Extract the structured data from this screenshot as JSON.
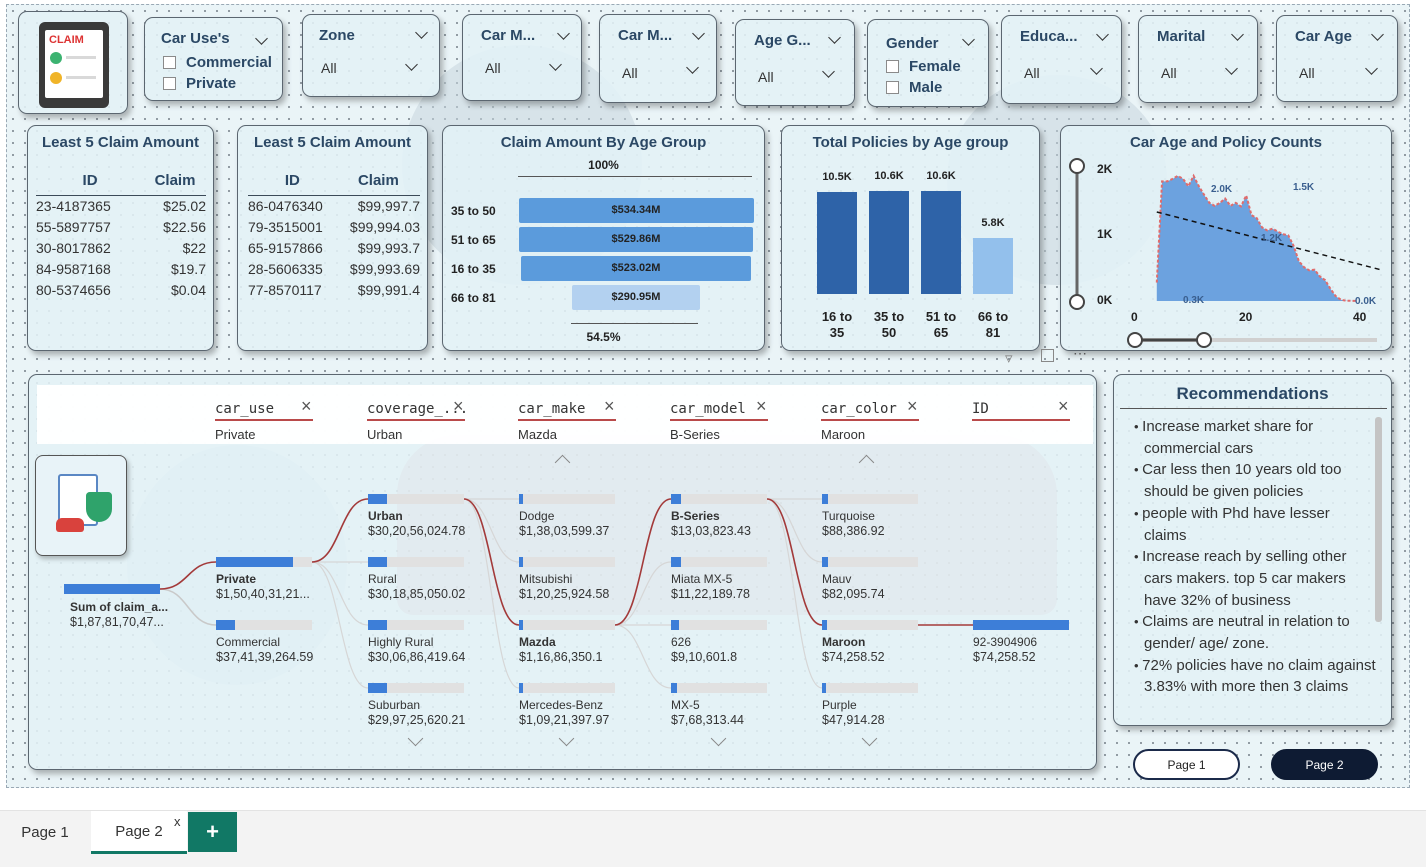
{
  "slicers": [
    {
      "title": "Car Use's",
      "type": "list",
      "options": [
        "Commercial",
        "Private"
      ]
    },
    {
      "title": "Zone",
      "type": "dropdown",
      "value": "All"
    },
    {
      "title": "Car M...",
      "type": "dropdown",
      "value": "All"
    },
    {
      "title": "Car M...",
      "type": "dropdown",
      "value": "All"
    },
    {
      "title": "Age G...",
      "type": "dropdown",
      "value": "All"
    },
    {
      "title": "Gender",
      "type": "list",
      "options": [
        "Female",
        "Male"
      ]
    },
    {
      "title": "Educa...",
      "type": "dropdown",
      "value": "All"
    },
    {
      "title": "Marital",
      "type": "dropdown",
      "value": "All"
    },
    {
      "title": "Car Age",
      "type": "dropdown",
      "value": "All"
    }
  ],
  "logo": {
    "text": "CLAIM"
  },
  "table_left": {
    "title": "Least 5 Claim Amount",
    "columns": [
      "ID",
      "Claim"
    ],
    "rows": [
      [
        "23-4187365",
        "$25.02"
      ],
      [
        "55-5897757",
        "$22.56"
      ],
      [
        "30-8017862",
        "$22"
      ],
      [
        "84-9587168",
        "$19.7"
      ],
      [
        "80-5374656",
        "$0.04"
      ]
    ]
  },
  "table_right": {
    "title": "Least 5 Claim Amount",
    "columns": [
      "ID",
      "Claim"
    ],
    "rows": [
      [
        "86-0476340",
        "$99,997.7"
      ],
      [
        "79-3515001",
        "$99,994.03"
      ],
      [
        "65-9157866",
        "$99,993.7"
      ],
      [
        "28-5606335",
        "$99,993.69"
      ],
      [
        "77-8570117",
        "$99,991.4"
      ]
    ]
  },
  "funnel": {
    "title": "Claim Amount By Age Group",
    "top_label": "100%",
    "bottom_label": "54.5%",
    "color": "#5b9bdc",
    "chart_data": {
      "type": "bar",
      "categories": [
        "35 to 50",
        "51 to 65",
        "16 to 35",
        "66 to 81"
      ],
      "values": [
        534.34,
        529.86,
        523.02,
        290.95
      ],
      "labels": [
        "$534.34M",
        "$529.86M",
        "$523.02M",
        "$290.95M"
      ]
    }
  },
  "policies": {
    "title": "Total Policies by Age group",
    "chart_data": {
      "type": "bar",
      "categories": [
        "16 to 35",
        "35 to 50",
        "51 to 65",
        "66 to 81"
      ],
      "values": [
        10500,
        10600,
        10600,
        5800
      ],
      "labels": [
        "10.5K",
        "10.6K",
        "10.6K",
        "5.8K"
      ]
    },
    "colors": [
      "#2e63a8",
      "#2e63a8",
      "#2e63a8",
      "#93c0ec"
    ]
  },
  "carage": {
    "title": "Car Age and Policy Counts",
    "y_ticks": [
      "2K",
      "1K",
      "0K"
    ],
    "x_ticks": [
      "0",
      "20",
      "40"
    ],
    "annotations": [
      "2.0K",
      "1.5K",
      "1.2K",
      "0.3K",
      "0.0K"
    ],
    "chart_data": {
      "type": "area",
      "x": [
        3,
        4,
        5,
        6,
        7,
        8,
        9,
        10,
        11,
        12,
        13,
        14,
        15,
        16,
        17,
        18,
        19,
        20,
        21,
        22,
        23,
        24,
        25,
        26,
        27,
        28,
        29,
        30,
        31,
        32,
        33,
        34,
        35,
        36,
        37,
        38,
        39,
        40,
        41
      ],
      "y": [
        300,
        1950,
        1950,
        1990,
        2040,
        1990,
        1870,
        2040,
        1870,
        1730,
        1600,
        1550,
        1600,
        1670,
        1550,
        1600,
        1540,
        1720,
        1400,
        1350,
        1200,
        1150,
        1180,
        1130,
        1090,
        1070,
        900,
        650,
        550,
        500,
        510,
        400,
        340,
        200,
        80,
        20,
        5,
        3,
        1
      ],
      "trend": [
        1450,
        500
      ],
      "ylim": [
        0,
        2200
      ],
      "xlim": [
        0,
        46
      ]
    }
  },
  "tree": {
    "levels": [
      {
        "field": "car_use",
        "value": "Private"
      },
      {
        "field": "coverage_...",
        "value": "Urban"
      },
      {
        "field": "car_make",
        "value": "Mazda"
      },
      {
        "field": "car_model",
        "value": "B-Series"
      },
      {
        "field": "car_color",
        "value": "Maroon"
      },
      {
        "field": "ID",
        "value": ""
      }
    ],
    "root": {
      "name": "Sum of claim_a...",
      "value": "$1,87,81,70,47..."
    },
    "columns": [
      [
        {
          "name": "Private",
          "value": "$1,50,40,31,21...",
          "fill": 0.8,
          "bold": true
        },
        {
          "name": "Commercial",
          "value": "$37,41,39,264.59",
          "fill": 0.2,
          "bold": false
        }
      ],
      [
        {
          "name": "Urban",
          "value": "$30,20,56,024.78",
          "fill": 0.2,
          "bold": true
        },
        {
          "name": "Rural",
          "value": "$30,18,85,050.02",
          "fill": 0.2,
          "bold": false
        },
        {
          "name": "Highly Rural",
          "value": "$30,06,86,419.64",
          "fill": 0.2,
          "bold": false
        },
        {
          "name": "Suburban",
          "value": "$29,97,25,620.21",
          "fill": 0.2,
          "bold": false
        }
      ],
      [
        {
          "name": "Dodge",
          "value": "$1,38,03,599.37",
          "fill": 0.04,
          "bold": false
        },
        {
          "name": "Mitsubishi",
          "value": "$1,20,25,924.58",
          "fill": 0.04,
          "bold": false
        },
        {
          "name": "Mazda",
          "value": "$1,16,86,350.1",
          "fill": 0.04,
          "bold": true
        },
        {
          "name": "Mercedes-Benz",
          "value": "$1,09,21,397.97",
          "fill": 0.04,
          "bold": false
        }
      ],
      [
        {
          "name": "B-Series",
          "value": "$13,03,823.43",
          "fill": 0.1,
          "bold": true
        },
        {
          "name": "Miata MX-5",
          "value": "$11,22,189.78",
          "fill": 0.1,
          "bold": false
        },
        {
          "name": "626",
          "value": "$9,10,601.8",
          "fill": 0.08,
          "bold": false
        },
        {
          "name": "MX-5",
          "value": "$7,68,313.44",
          "fill": 0.06,
          "bold": false
        }
      ],
      [
        {
          "name": "Turquoise",
          "value": "$88,386.92",
          "fill": 0.06,
          "bold": false
        },
        {
          "name": "Mauv",
          "value": "$82,095.74",
          "fill": 0.06,
          "bold": false
        },
        {
          "name": "Maroon",
          "value": "$74,258.52",
          "fill": 0.05,
          "bold": true
        },
        {
          "name": "Purple",
          "value": "$47,914.28",
          "fill": 0.04,
          "bold": false
        }
      ],
      [
        {
          "name": "92-3904906",
          "value": "$74,258.52",
          "fill": 1.0,
          "bold": false
        }
      ]
    ]
  },
  "recommendations": {
    "title": "Recommendations",
    "items": [
      "Increase market share for commercial cars",
      "Car less then 10 years old too should be given policies",
      "people with Phd have lesser claims",
      "Increase reach by selling other cars makers. top 5 car makers have 32% of business",
      "Claims are neutral in relation to gender/ age/ zone.",
      "72% policies have no claim against 3.83% with more then 3 claims"
    ]
  },
  "nav": {
    "page1": "Page 1",
    "page2": "Page 2"
  },
  "tabs": {
    "items": [
      "Page 1",
      "Page 2"
    ],
    "close": "x",
    "add": "+"
  }
}
